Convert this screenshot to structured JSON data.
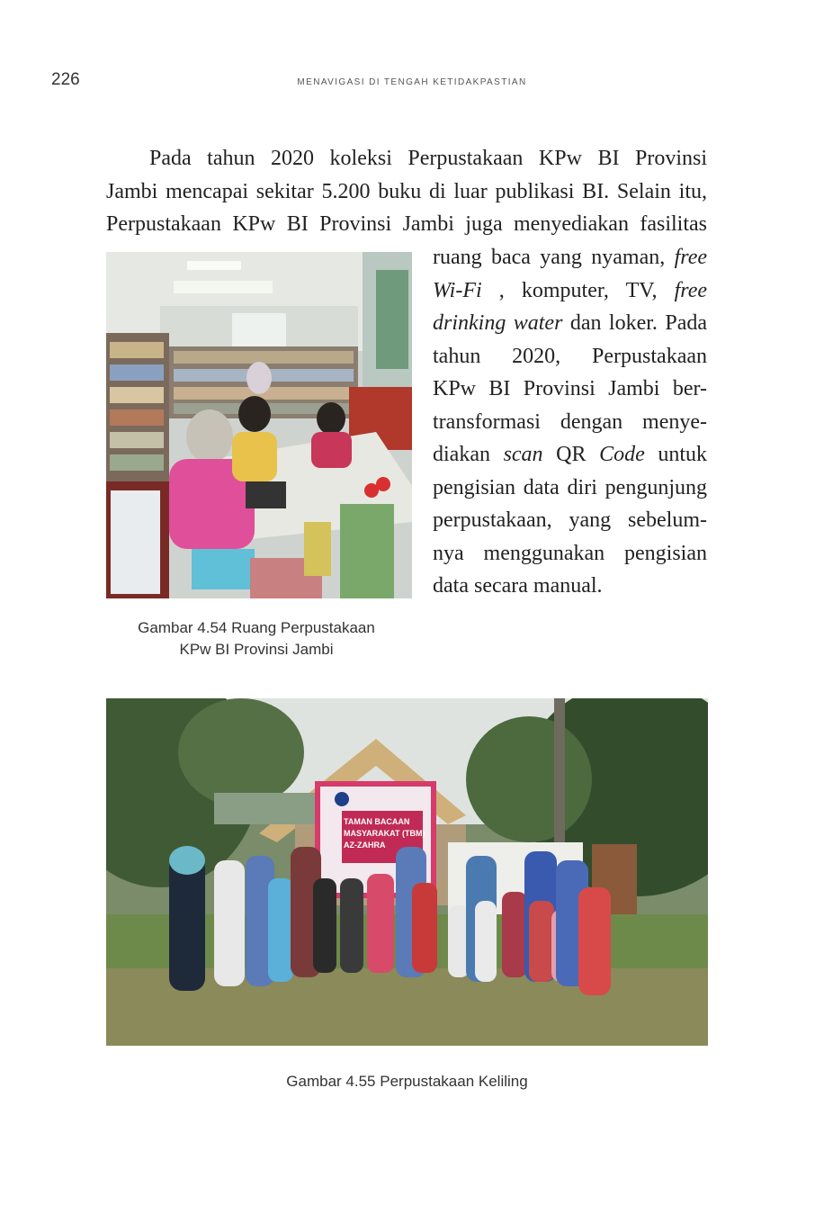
{
  "header": {
    "page_number": "226",
    "running_title": "MENAVIGASI DI TENGAH KETIDAKPASTIAN"
  },
  "body": {
    "para_top": [
      "Pada tahun 2020 koleksi Perpustakaan KPw BI Provinsi",
      "Jambi mencapai sekitar 5.200 buku di luar publikasi BI. Selain itu,",
      "Perpustakaan KPw BI Provinsi Jambi juga menyediakan fasilitas"
    ],
    "para_right": {
      "l1_a": "ruang baca yang nyaman, ",
      "l1_b": "free",
      "l2_a": "Wi-Fi",
      "l2_b": " , komputer, TV, ",
      "l2_c": "free",
      "l3_a": "drinking water",
      "l3_b": " dan loker. Pada",
      "l4": "tahun 2020, Perpustakaan",
      "l5": "KPw BI Provinsi Jambi ber-",
      "l6": "transformasi dengan menye-",
      "l7_a": "diakan ",
      "l7_b": "scan",
      "l7_c": " QR ",
      "l7_d": "Code",
      "l7_e": " untuk",
      "l8": "pengisian data diri pengunjung",
      "l9": "perpustakaan, yang sebelum-",
      "l10": "nya menggunakan pengisian",
      "l11": "data secara manual."
    }
  },
  "figures": {
    "fig1_caption_l1": "Gambar 4.54 Ruang Perpustakaan",
    "fig1_caption_l2": "KPw BI Provinsi Jambi",
    "fig2_caption": "Gambar 4.55 Perpustakaan Keliling",
    "fig2_banner_l1": "TAMAN BACAAN",
    "fig2_banner_l2": "MASYARAKAT (TBM)",
    "fig2_banner_l3": "AZ-ZAHRA"
  }
}
